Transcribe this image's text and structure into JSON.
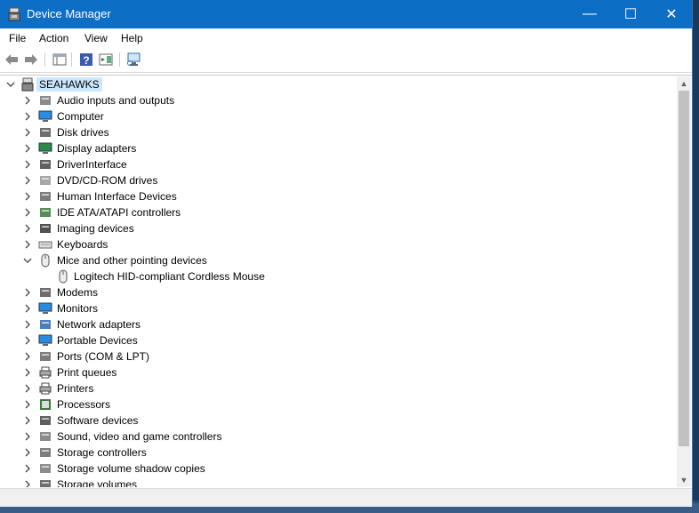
{
  "window": {
    "title": "Device Manager"
  },
  "window_controls": {
    "minimize": "—",
    "maximize": "☐",
    "close": "✕"
  },
  "menu": [
    "File",
    "Action",
    "View",
    "Help"
  ],
  "toolbar_icons": [
    "back-arrow-icon",
    "forward-arrow-icon",
    "properties-pane-icon",
    "help-icon",
    "show-hide-console-tree-icon",
    "scan-hardware-icon"
  ],
  "tree": {
    "root": "SEAHAWKS",
    "categories": [
      {
        "label": "Audio inputs and outputs",
        "icon": "speaker-icon",
        "expanded": false
      },
      {
        "label": "Computer",
        "icon": "computer-icon",
        "expanded": false
      },
      {
        "label": "Disk drives",
        "icon": "disk-drive-icon",
        "expanded": false
      },
      {
        "label": "Display adapters",
        "icon": "display-adapter-icon",
        "expanded": false
      },
      {
        "label": "DriverInterface",
        "icon": "driver-interface-icon",
        "expanded": false
      },
      {
        "label": "DVD/CD-ROM drives",
        "icon": "dvd-drive-icon",
        "expanded": false
      },
      {
        "label": "Human Interface Devices",
        "icon": "hid-icon",
        "expanded": false
      },
      {
        "label": "IDE ATA/ATAPI controllers",
        "icon": "ide-controller-icon",
        "expanded": false
      },
      {
        "label": "Imaging devices",
        "icon": "camera-icon",
        "expanded": false
      },
      {
        "label": "Keyboards",
        "icon": "keyboard-icon",
        "expanded": false
      },
      {
        "label": "Mice and other pointing devices",
        "icon": "mouse-icon",
        "expanded": true
      },
      {
        "label": "Logitech HID-compliant Cordless Mouse",
        "icon": "mouse-icon",
        "child": true
      },
      {
        "label": "Modems",
        "icon": "modem-icon",
        "expanded": false
      },
      {
        "label": "Monitors",
        "icon": "monitor-icon",
        "expanded": false
      },
      {
        "label": "Network adapters",
        "icon": "network-adapter-icon",
        "expanded": false
      },
      {
        "label": "Portable Devices",
        "icon": "portable-device-icon",
        "expanded": false
      },
      {
        "label": "Ports (COM & LPT)",
        "icon": "port-icon",
        "expanded": false
      },
      {
        "label": "Print queues",
        "icon": "print-queue-icon",
        "expanded": false
      },
      {
        "label": "Printers",
        "icon": "printer-icon",
        "expanded": false
      },
      {
        "label": "Processors",
        "icon": "processor-icon",
        "expanded": false
      },
      {
        "label": "Software devices",
        "icon": "software-device-icon",
        "expanded": false
      },
      {
        "label": "Sound, video and game controllers",
        "icon": "sound-icon",
        "expanded": false
      },
      {
        "label": "Storage controllers",
        "icon": "storage-controller-icon",
        "expanded": false
      },
      {
        "label": "Storage volume shadow copies",
        "icon": "shadow-copy-icon",
        "expanded": false
      },
      {
        "label": "Storage volumes",
        "icon": "storage-volume-icon",
        "expanded": false
      }
    ]
  },
  "colors": {
    "titlebar": "#0d6ec6",
    "selection": "#cce8ff"
  }
}
